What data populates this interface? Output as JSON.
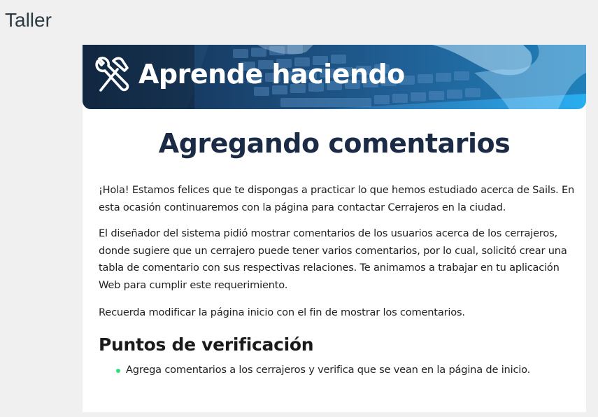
{
  "page": {
    "heading": "Taller"
  },
  "banner": {
    "title": "Aprende haciendo",
    "icon": "tools-icon",
    "colors": {
      "start": "#132b46",
      "end": "#29aef0"
    }
  },
  "content": {
    "title": "Agregando comentarios",
    "paragraphs": [
      "¡Hola! Estamos felices que te dispongas a practicar lo que hemos estudiado acerca de Sails. En esta ocasión continuaremos con la página para contactar Cerrajeros en la ciudad.",
      "El diseñador del sistema pidió mostrar comentarios de los usuarios acerca de los cerrajeros, donde sugiere que un cerrajero puede tener varios comentarios, por lo cual, solicitó crear una tabla de comentario con sus respectivas relaciones. Te animamos a trabajar en tu aplicación Web para cumplir este requerimiento.",
      "Recuerda modificar la página inicio con el fin de mostrar los comentarios."
    ],
    "section_title": "Puntos de verificación",
    "checklist": [
      "Agrega comentarios a los cerrajeros y verifica que se vean en la página de inicio."
    ],
    "bullet_color": "#2ee07a"
  }
}
